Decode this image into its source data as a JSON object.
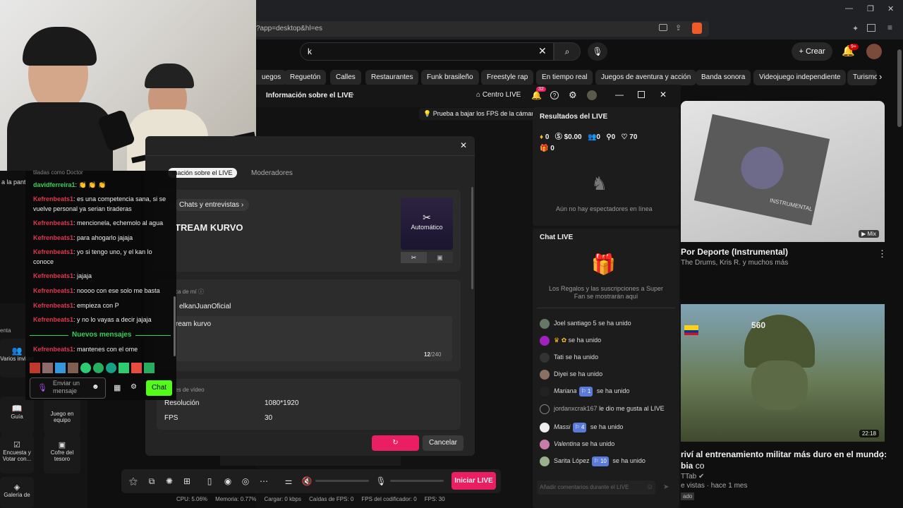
{
  "browser": {
    "url": "?app=desktop&hl=es",
    "window_controls": [
      "—",
      "❐",
      "✕"
    ]
  },
  "youtube": {
    "search_value": "k",
    "create_label": "Crear",
    "notif_count": "9+",
    "chips": [
      "uegos",
      "Reguetón",
      "Calles",
      "Restaurantes",
      "Funk brasileño",
      "Freestyle rap",
      "En tiempo real",
      "Juegos de aventura y acción",
      "Banda sonora",
      "Videojuego independiente",
      "Turismo"
    ],
    "video1": {
      "title": "Por Deporte (Instrumental)",
      "meta": "The Drums, Kris R. y muchos más",
      "badge": "Mix",
      "cover_text": "INSTRUMENTAL"
    },
    "video2": {
      "title_line1": "riví al entrenamiento militar más duro en el mundo:",
      "title_line2": "bia",
      "channel_suffix": "co",
      "channel": "TTab",
      "views": "e vistas · hace 1 mes",
      "duration": "22:18",
      "helmet_num": "560",
      "extra": "ado"
    }
  },
  "studio": {
    "title": "Información sobre el LIVE",
    "centro": "Centro LIVE",
    "notif": "32",
    "tip": "Prueba a bajar los FPS de la cámara"
  },
  "modal": {
    "tab1": "mación sobre el LIVE",
    "tab2": "Moderadores",
    "category": "Chats y entrevistas",
    "stream_title": "TREAM KURVO",
    "cover_label": "Automático",
    "about_label": "ca de mí",
    "handle": "elkanJuanOficial",
    "desc_value": "ream kurvo",
    "counter_val": "12",
    "counter_max": "/240",
    "video_label": "tes de vídeo",
    "res_label": "Resolución",
    "res_value": "1080*1920",
    "fps_label": "FPS",
    "fps_value": "30",
    "cancel": "Cancelar"
  },
  "chat": {
    "top_text": "tiladas como Doctor",
    "messages": [
      {
        "name": "davidferreira1",
        "text": "👏 👏 👏",
        "green": true
      },
      {
        "name": "Kefrenbeats1",
        "text": "es una competencia sana, si se vuelve personal ya serian tiraderas"
      },
      {
        "name": "Kefrenbeats1",
        "text": "mencionela, echemolo al agua"
      },
      {
        "name": "Kefrenbeats1",
        "text": "para ahogarlo jajaja"
      },
      {
        "name": "Kefrenbeats1",
        "text": "yo si tengo uno, y el kan lo conoce"
      },
      {
        "name": "Kefrenbeats1",
        "text": "jajaja"
      },
      {
        "name": "Kefrenbeats1",
        "text": "noooo con ese solo me basta"
      },
      {
        "name": "Kefrenbeats1",
        "text": "empieza con P"
      },
      {
        "name": "Kefrenbeats1",
        "text": "y no lo vayas a decir jajaja"
      }
    ],
    "new_label": "Nuevos mensajes",
    "last": {
      "name": "Kefrenbeats1",
      "text": "mantenes con el ome"
    },
    "input_placeholder": "Enviar un mensaje",
    "send": "Chat",
    "side_text": "a la pant"
  },
  "left_panel": {
    "cuenta": "enta",
    "varios": "Varios invitad",
    "guia": "Guía",
    "juego": "Juego en equipo",
    "encuesta": "Encuesta y Votar con...",
    "cofre": "Cofre del tesoro",
    "galeria": "Galería de"
  },
  "results": {
    "title": "Resultados del LIVE",
    "diamonds": "0",
    "money": "$0.00",
    "viewers": "0",
    "followers": "0",
    "likes": "70",
    "gifts": "0",
    "no_viewers": "Aún no hay espectadores en línea"
  },
  "live_chat": {
    "title": "Chat LIVE",
    "gifts_note": "Los Regalos y las suscripciones a Super Fan se mostrarán aquí",
    "rows": [
      {
        "name": "Joel santiago 5",
        "text": "se ha unido"
      },
      {
        "name": "",
        "text": "se ha unido"
      },
      {
        "name": "Tati",
        "text": "se ha unido"
      },
      {
        "name": "Diyei",
        "text": "se ha unido"
      },
      {
        "name": "Mariana",
        "badge": "1",
        "text": "se ha unido"
      },
      {
        "name": "jordanxcrak167",
        "text": "le dio me gusta al LIVE"
      },
      {
        "name": "Massi",
        "badge": "4",
        "text": "se ha unido"
      },
      {
        "name": "Valentina",
        "text": "se ha unido"
      },
      {
        "name": "Sarita López",
        "badge": "10",
        "text": "se ha unido"
      }
    ],
    "input_placeholder": "Añadir comentarios durante el LIVE"
  },
  "toolbar": {
    "go_live": "Iniciar LIVE"
  },
  "status": {
    "cpu": "CPU:  5.06%",
    "memoria": "Memoria:  0.77%",
    "cargar": "Cargar:  0 kbps",
    "caidas": "Caídas de FPS:  0",
    "fps_cod": "FPS del codificador:  0",
    "fps": "FPS:  30"
  },
  "colors": {
    "accent": "#e91e63",
    "chat_name": "#e0364f",
    "green": "#34d058"
  }
}
